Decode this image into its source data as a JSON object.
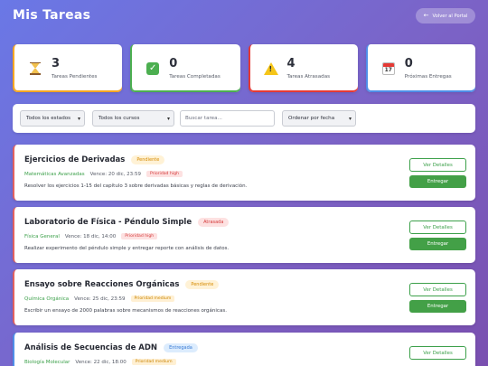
{
  "header": {
    "title": "Mis Tareas",
    "back_label": "Volver al Portal"
  },
  "stats": [
    {
      "value": "3",
      "label": "Tareas Pendientes",
      "icon": "hourglass-icon",
      "color": "#f5a623"
    },
    {
      "value": "0",
      "label": "Tareas Completadas",
      "icon": "check-mark-icon",
      "color": "#4caf50"
    },
    {
      "value": "4",
      "label": "Tareas Atrasadas",
      "icon": "warning-icon",
      "color": "#e53935"
    },
    {
      "value": "0",
      "label": "Próximas Entregas",
      "icon": "calendar-icon",
      "color": "#4f8ee8"
    }
  ],
  "filters": {
    "state": "Todos los estados",
    "course": "Todos los cursos",
    "search_placeholder": "Buscar tarea...",
    "sort": "Ordenar por fecha"
  },
  "actions": {
    "details_label": "Ver Detalles",
    "submit_label": "Entregar"
  },
  "tasks": [
    {
      "title": "Ejercicios de Derivadas",
      "status": "Pendiente",
      "course": "Matemáticas Avanzadas",
      "due": "Vence: 20 dic, 23:59",
      "priority": "Prioridad high",
      "description": "Resolver los ejercicios 1-15 del capítulo 3 sobre derivadas básicas y reglas de derivación."
    },
    {
      "title": "Laboratorio de Física - Péndulo Simple",
      "status": "Atrasada",
      "course": "Física General",
      "due": "Vence: 18 dic, 14:00",
      "priority": "Prioridad high",
      "description": "Realizar experimento del péndulo simple y entregar reporte con análisis de datos."
    },
    {
      "title": "Ensayo sobre Reacciones Orgánicas",
      "status": "Pendiente",
      "course": "Química Orgánica",
      "due": "Vence: 25 dic, 23:59",
      "priority": "Prioridad medium",
      "description": "Escribir un ensayo de 2000 palabras sobre mecanismos de reacciones orgánicas."
    },
    {
      "title": "Análisis de Secuencias de ADN",
      "status": "Entregada",
      "course": "Biología Molecular",
      "due": "Vence: 22 dic, 18:00",
      "priority": "Prioridad medium",
      "description": ""
    }
  ]
}
